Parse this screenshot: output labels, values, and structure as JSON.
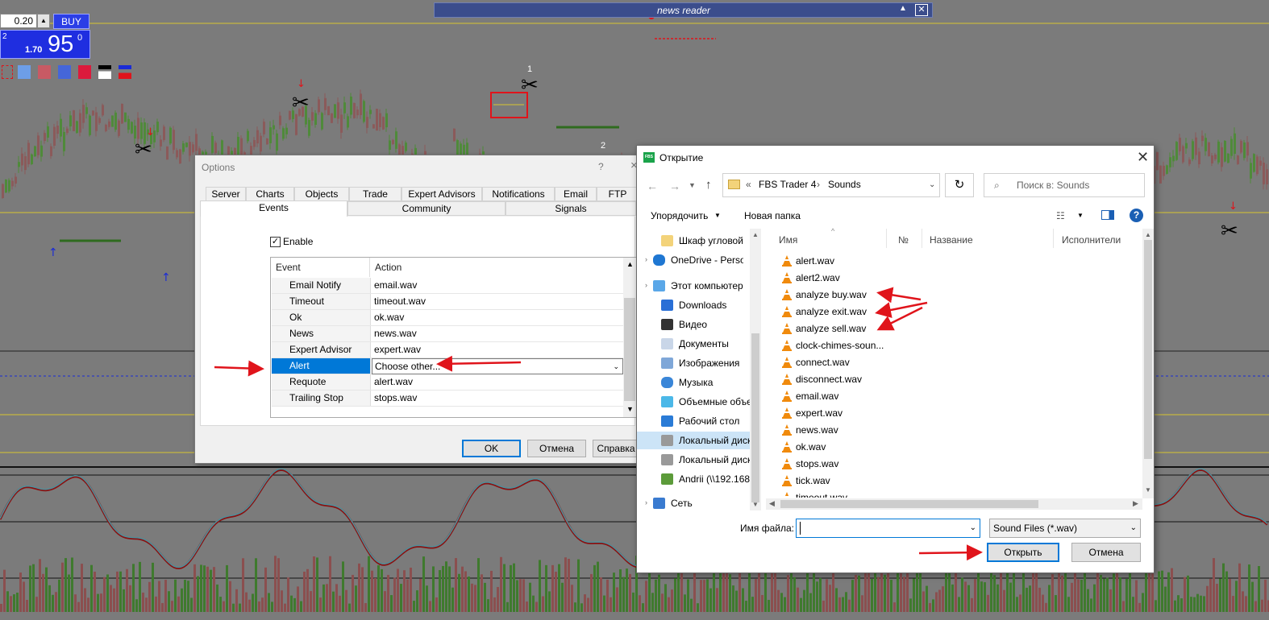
{
  "trade_panel": {
    "lot_value": "0.20",
    "buy_label": "BUY",
    "left_digit": "2",
    "price_small": "1.70",
    "price_big": "95",
    "price_sup": "0"
  },
  "colors": {
    "chart_bg": "#7b7b7b",
    "accent_blue": "#0078d7",
    "arrow_red": "#e0141b",
    "buy_blue": "#2b3ee6"
  },
  "news_reader": {
    "title": "news reader",
    "collapse_icon": "triangle-up-icon",
    "close_icon": "close-icon"
  },
  "chart": {
    "labels": [
      "1",
      "2"
    ]
  },
  "options_dialog": {
    "title": "Options",
    "help": "?",
    "close": "×",
    "tabs_row1": [
      "Server",
      "Charts",
      "Objects",
      "Trade",
      "Expert Advisors",
      "Notifications",
      "Email",
      "FTP"
    ],
    "tabs_row2": [
      "Events",
      "Community",
      "Signals"
    ],
    "enable_label": "Enable",
    "enable_checked": true,
    "columns": [
      "Event",
      "Action"
    ],
    "rows": [
      {
        "event": "Email Notify",
        "action": "email.wav",
        "icon": "bell-icon"
      },
      {
        "event": "Timeout",
        "action": "timeout.wav",
        "icon": "bell-icon"
      },
      {
        "event": "Ok",
        "action": "ok.wav",
        "icon": "bell-icon"
      },
      {
        "event": "News",
        "action": "news.wav",
        "icon": "bell-disabled-icon"
      },
      {
        "event": "Expert Advisor",
        "action": "expert.wav",
        "icon": "bell-icon"
      },
      {
        "event": "Alert",
        "action": "Choose other...",
        "icon": "bell-icon"
      },
      {
        "event": "Requote",
        "action": "alert.wav",
        "icon": "bell-icon"
      },
      {
        "event": "Trailing Stop",
        "action": "stops.wav",
        "icon": "bell-disabled-icon"
      }
    ],
    "ok_label": "OK",
    "cancel_label": "Отмена",
    "help_label": "Справка"
  },
  "file_dialog": {
    "title": "Открытие",
    "logo_text": "FBS",
    "breadcrumb": [
      "«",
      "FBS Trader 4",
      "›",
      "Sounds"
    ],
    "search_placeholder": "Поиск в: Sounds",
    "organize_label": "Упорядочить",
    "new_folder_label": "Новая папка",
    "nav_items": [
      {
        "label": "Шкаф угловой",
        "icon": "folder-icon"
      },
      {
        "label": "OneDrive - Personal",
        "icon": "cloud-icon"
      },
      {
        "label": "Этот компьютер",
        "icon": "computer-icon"
      },
      {
        "label": "Downloads",
        "icon": "download-icon"
      },
      {
        "label": "Видео",
        "icon": "video-icon"
      },
      {
        "label": "Документы",
        "icon": "document-icon"
      },
      {
        "label": "Изображения",
        "icon": "image-icon"
      },
      {
        "label": "Музыка",
        "icon": "music-icon"
      },
      {
        "label": "Объемные объекты",
        "icon": "cube-icon"
      },
      {
        "label": "Рабочий стол",
        "icon": "desktop-icon"
      },
      {
        "label": "Локальный диск (C:)",
        "icon": "drive-icon"
      },
      {
        "label": "Локальный диск (D:)",
        "icon": "drive-icon"
      },
      {
        "label": "Andrii (\\\\192.168",
        "icon": "network-drive-icon"
      },
      {
        "label": "Сеть",
        "icon": "network-icon"
      }
    ],
    "columns": [
      "Имя",
      "№",
      "Название",
      "Исполнители"
    ],
    "files": [
      "alert.wav",
      "alert2.wav",
      "analyze buy.wav",
      "analyze exit.wav",
      "analyze sell.wav",
      "clock-chimes-soun...",
      "connect.wav",
      "disconnect.wav",
      "email.wav",
      "expert.wav",
      "news.wav",
      "ok.wav",
      "stops.wav",
      "tick.wav",
      "timeout.wav"
    ],
    "filename_label": "Имя файла:",
    "filename_value": "",
    "filter_value": "Sound Files (*.wav)",
    "open_label": "Открыть",
    "cancel_label": "Отмена"
  }
}
